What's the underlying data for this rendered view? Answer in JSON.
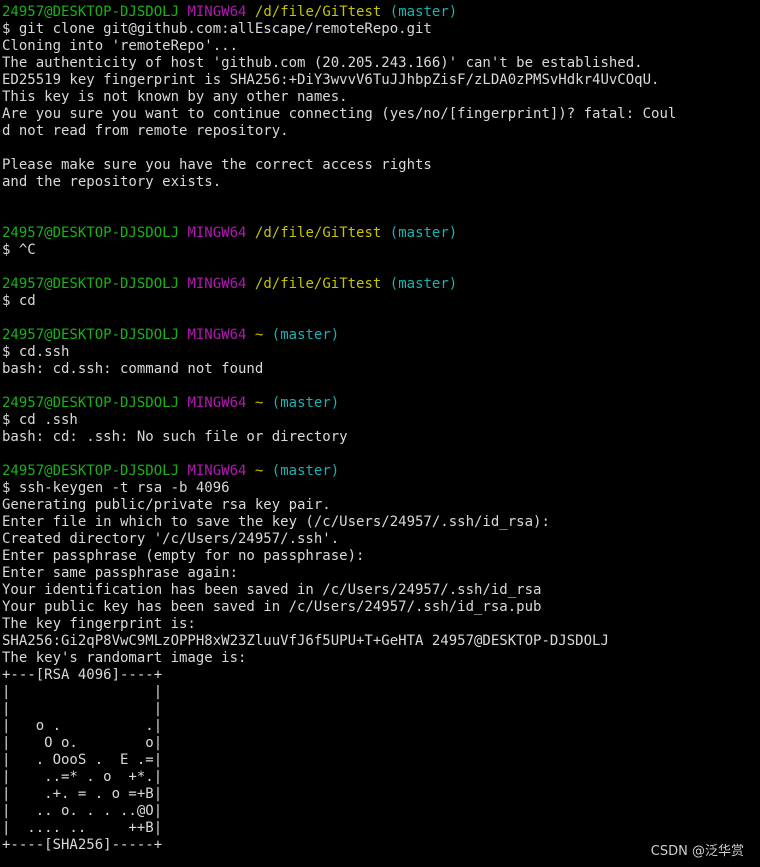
{
  "terminal": {
    "app": "MINGW64 Git Bash",
    "colors": {
      "background": "#000000",
      "text": "#d9d9d9",
      "user": "#18b218",
      "system": "#b218b2",
      "path": "#c7c400",
      "branch": "#18b2b2"
    },
    "lines": [
      {
        "type": "prompt",
        "user": "24957@DESKTOP-DJSDOLJ",
        "sys": "MINGW64",
        "path": "/d/file/GiTtest",
        "branch": "(master)"
      },
      {
        "type": "text",
        "text": "$ git clone git@github.com:allEscape/remoteRepo.git"
      },
      {
        "type": "text",
        "text": "Cloning into 'remoteRepo'..."
      },
      {
        "type": "text",
        "text": "The authenticity of host 'github.com (20.205.243.166)' can't be established."
      },
      {
        "type": "text",
        "text": "ED25519 key fingerprint is SHA256:+DiY3wvvV6TuJJhbpZisF/zLDA0zPMSvHdkr4UvCOqU."
      },
      {
        "type": "text",
        "text": "This key is not known by any other names."
      },
      {
        "type": "text",
        "text": "Are you sure you want to continue connecting (yes/no/[fingerprint])? fatal: Coul"
      },
      {
        "type": "text",
        "text": "d not read from remote repository."
      },
      {
        "type": "text",
        "text": ""
      },
      {
        "type": "text",
        "text": "Please make sure you have the correct access rights"
      },
      {
        "type": "text",
        "text": "and the repository exists."
      },
      {
        "type": "text",
        "text": ""
      },
      {
        "type": "text",
        "text": ""
      },
      {
        "type": "prompt",
        "user": "24957@DESKTOP-DJSDOLJ",
        "sys": "MINGW64",
        "path": "/d/file/GiTtest",
        "branch": "(master)"
      },
      {
        "type": "text",
        "text": "$ ^C"
      },
      {
        "type": "text",
        "text": ""
      },
      {
        "type": "prompt",
        "user": "24957@DESKTOP-DJSDOLJ",
        "sys": "MINGW64",
        "path": "/d/file/GiTtest",
        "branch": "(master)"
      },
      {
        "type": "text",
        "text": "$ cd"
      },
      {
        "type": "text",
        "text": ""
      },
      {
        "type": "prompt",
        "user": "24957@DESKTOP-DJSDOLJ",
        "sys": "MINGW64",
        "path": "~",
        "branch": "(master)"
      },
      {
        "type": "text",
        "text": "$ cd.ssh"
      },
      {
        "type": "text",
        "text": "bash: cd.ssh: command not found"
      },
      {
        "type": "text",
        "text": ""
      },
      {
        "type": "prompt",
        "user": "24957@DESKTOP-DJSDOLJ",
        "sys": "MINGW64",
        "path": "~",
        "branch": "(master)"
      },
      {
        "type": "text",
        "text": "$ cd .ssh"
      },
      {
        "type": "text",
        "text": "bash: cd: .ssh: No such file or directory"
      },
      {
        "type": "text",
        "text": ""
      },
      {
        "type": "prompt",
        "user": "24957@DESKTOP-DJSDOLJ",
        "sys": "MINGW64",
        "path": "~",
        "branch": "(master)"
      },
      {
        "type": "text",
        "text": "$ ssh-keygen -t rsa -b 4096"
      },
      {
        "type": "text",
        "text": "Generating public/private rsa key pair."
      },
      {
        "type": "text",
        "text": "Enter file in which to save the key (/c/Users/24957/.ssh/id_rsa):"
      },
      {
        "type": "text",
        "text": "Created directory '/c/Users/24957/.ssh'."
      },
      {
        "type": "text",
        "text": "Enter passphrase (empty for no passphrase):"
      },
      {
        "type": "text",
        "text": "Enter same passphrase again:"
      },
      {
        "type": "text",
        "text": "Your identification has been saved in /c/Users/24957/.ssh/id_rsa"
      },
      {
        "type": "text",
        "text": "Your public key has been saved in /c/Users/24957/.ssh/id_rsa.pub"
      },
      {
        "type": "text",
        "text": "The key fingerprint is:"
      },
      {
        "type": "text",
        "text": "SHA256:Gi2qP8VwC9MLzOPPH8xW23ZluuVfJ6f5UPU+T+GeHTA 24957@DESKTOP-DJSDOLJ"
      },
      {
        "type": "text",
        "text": "The key's randomart image is:"
      },
      {
        "type": "text",
        "text": "+---[RSA 4096]----+"
      },
      {
        "type": "text",
        "text": "|                 |"
      },
      {
        "type": "text",
        "text": "|                 |"
      },
      {
        "type": "text",
        "text": "|   o .          .|"
      },
      {
        "type": "text",
        "text": "|    O o.        o|"
      },
      {
        "type": "text",
        "text": "|   . OooS .  E .=|"
      },
      {
        "type": "text",
        "text": "|    ..=* . o  +*.|"
      },
      {
        "type": "text",
        "text": "|    .+. = . o =+B|"
      },
      {
        "type": "text",
        "text": "|   .. o. . . ..@O|"
      },
      {
        "type": "text",
        "text": "|  .... ..     ++B|"
      },
      {
        "type": "text",
        "text": "+----[SHA256]-----+"
      }
    ]
  },
  "watermark": "CSDN @泛华赏"
}
